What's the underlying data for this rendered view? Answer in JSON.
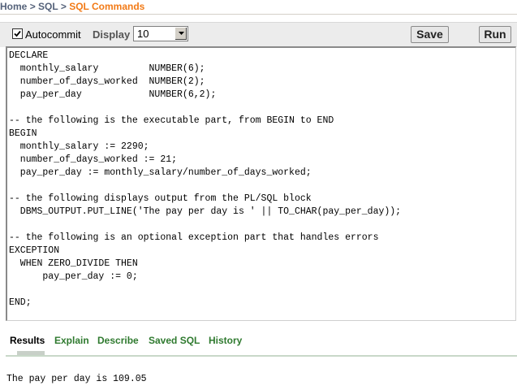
{
  "breadcrumb": {
    "home": "Home",
    "separator": ">",
    "sql": "SQL",
    "current": "SQL Commands"
  },
  "toolbar": {
    "autocommit_label": "Autocommit",
    "autocommit_checked": true,
    "display_label": "Display",
    "display_value": "10",
    "save_label": "Save",
    "run_label": "Run"
  },
  "editor": {
    "code": "DECLARE\n  monthly_salary         NUMBER(6);\n  number_of_days_worked  NUMBER(2);\n  pay_per_day            NUMBER(6,2);\n\n-- the following is the executable part, from BEGIN to END\nBEGIN\n  monthly_salary := 2290;\n  number_of_days_worked := 21;\n  pay_per_day := monthly_salary/number_of_days_worked;\n\n-- the following displays output from the PL/SQL block\n  DBMS_OUTPUT.PUT_LINE('The pay per day is ' || TO_CHAR(pay_per_day));\n\n-- the following is an optional exception part that handles errors\nEXCEPTION\n  WHEN ZERO_DIVIDE THEN\n      pay_per_day := 0;\n\nEND;"
  },
  "tabs": [
    {
      "label": "Results",
      "active": true
    },
    {
      "label": "Explain",
      "active": false
    },
    {
      "label": "Describe",
      "active": false
    },
    {
      "label": "Saved SQL",
      "active": false
    },
    {
      "label": "History",
      "active": false
    }
  ],
  "results": {
    "output": "The pay per day is 109.05"
  },
  "colors": {
    "breadcrumb_current": "#f27a16",
    "tab_link": "#2f7a2f",
    "toolbar_bg": "#ececec"
  }
}
